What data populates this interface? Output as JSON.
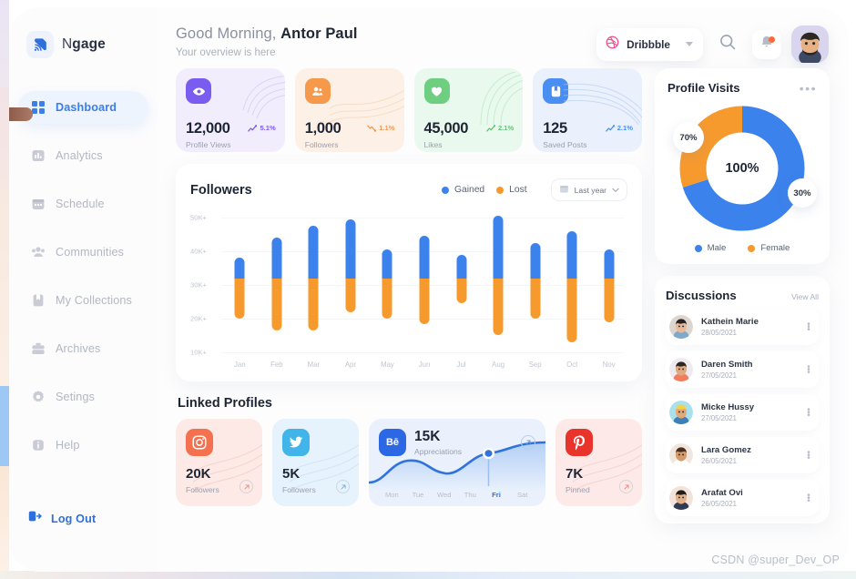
{
  "brand": {
    "name_prefix": "N",
    "name_suffix": "gage",
    "logo_icon": "cast-signal-icon"
  },
  "sidebar": {
    "items": [
      {
        "label": "Dashboard",
        "icon": "grid-icon",
        "active": true
      },
      {
        "label": "Analytics",
        "icon": "bar-chart-icon",
        "active": false
      },
      {
        "label": "Schedule",
        "icon": "calendar-icon",
        "active": false
      },
      {
        "label": "Communities",
        "icon": "people-icon",
        "active": false
      },
      {
        "label": "My Collections",
        "icon": "bookmark-icon",
        "active": false
      },
      {
        "label": "Archives",
        "icon": "briefcase-icon",
        "active": false
      },
      {
        "label": "Setings",
        "icon": "gear-icon",
        "active": false
      },
      {
        "label": "Help",
        "icon": "info-icon",
        "active": false
      }
    ],
    "logout": {
      "label": "Log Out",
      "icon": "logout-icon"
    }
  },
  "header": {
    "greeting_prefix": "Good Morning, ",
    "greeting_name": "Antor Paul",
    "subtitle": "Your overview is here",
    "brand_pill": {
      "label": "Dribbble",
      "icon": "dribbble-icon"
    },
    "search_icon": "search-icon",
    "bell_icon": "bell-icon",
    "avatar": "user-avatar"
  },
  "stats": [
    {
      "value": "12,000",
      "label": "Profile Views",
      "delta": "5.1%",
      "trend": "up",
      "icon": "eye-icon",
      "accent": "#7b5cf0",
      "bg": "#f1edfd",
      "delta_color": "#7b5cf0"
    },
    {
      "value": "1,000",
      "label": "Followers",
      "delta": "1.1%",
      "trend": "down",
      "icon": "users-icon",
      "accent": "#f6994a",
      "bg": "#fdf0e6",
      "delta_color": "#f0984d"
    },
    {
      "value": "45,000",
      "label": "Likes",
      "delta": "2.1%",
      "trend": "up",
      "icon": "heart-icon",
      "accent": "#6dcf7f",
      "bg": "#eaf9ee",
      "delta_color": "#5ec473"
    },
    {
      "value": "125",
      "label": "Saved Posts",
      "delta": "2.1%",
      "trend": "up",
      "icon": "bookmark-icon",
      "accent": "#4b8ef2",
      "bg": "#eaf1fd",
      "delta_color": "#4b8ef2"
    }
  ],
  "followers_card": {
    "title": "Followers",
    "legend": [
      {
        "label": "Gained",
        "color": "#3b82ec"
      },
      {
        "label": "Lost",
        "color": "#f79a2e"
      }
    ],
    "range": {
      "label": "Last year",
      "icon": "calendar-icon"
    }
  },
  "chart_data": {
    "type": "bar",
    "title": "Followers",
    "xlabel": "",
    "ylabel": "",
    "ylim": [
      5000,
      55000
    ],
    "ytick_labels": [
      "50K+",
      "40K+",
      "30K+",
      "20K+",
      "10K+"
    ],
    "ytick_values": [
      50000,
      40000,
      30000,
      20000,
      10000
    ],
    "categories": [
      "Jan",
      "Feb",
      "Mar",
      "Apr",
      "May",
      "Jun",
      "Jul",
      "Aug",
      "Sep",
      "Oct",
      "Nov"
    ],
    "grid": true,
    "legend_position": "top-right",
    "stacked_split_value": 32000,
    "series": [
      {
        "name": "Gained",
        "color": "#3b82ec",
        "values": [
          38000,
          44000,
          47500,
          49500,
          40500,
          44500,
          39000,
          50500,
          42500,
          46000,
          40500
        ]
      },
      {
        "name": "Lost",
        "color": "#f79a2e",
        "values": [
          20000,
          16500,
          16500,
          22000,
          20000,
          18500,
          24500,
          15000,
          20000,
          13000,
          19000
        ]
      }
    ]
  },
  "linked_profiles": {
    "title": "Linked Profiles",
    "cards": [
      {
        "kind": "simple",
        "network": "instagram",
        "icon": "instagram-icon",
        "value": "20K",
        "label": "Followers",
        "bg": "#fdeae6",
        "icon_bg": "#f4714f"
      },
      {
        "kind": "simple",
        "network": "twitter",
        "icon": "twitter-icon",
        "value": "5K",
        "label": "Followers",
        "bg": "#e6f2fc",
        "icon_bg": "#41b4ea"
      },
      {
        "kind": "chart",
        "network": "behance",
        "icon": "behance-icon",
        "value": "15K",
        "label": "Appreciations",
        "bg": "#eaf1fc",
        "icon_bg": "#2c68e4",
        "days": [
          "Mon",
          "Tue",
          "Wed",
          "Thu",
          "Fri",
          "Sat"
        ],
        "active_day": "Fri"
      },
      {
        "kind": "simple",
        "network": "pinterest",
        "icon": "pinterest-icon",
        "value": "7K",
        "label": "Pinned",
        "bg": "#fdeae8",
        "icon_bg": "#e8342a"
      }
    ]
  },
  "profile_visits": {
    "title": "Profile Visits",
    "menu_icon": "more-horizontal-icon",
    "center_label": "100%",
    "segments": [
      {
        "label": "Male",
        "value": 70,
        "display": "70%",
        "color": "#3b82ec"
      },
      {
        "label": "Female",
        "value": 30,
        "display": "30%",
        "color": "#f79a2e"
      }
    ]
  },
  "discussions": {
    "title": "Discussions",
    "view_all": "View All",
    "items": [
      {
        "name": "Kathein Marie",
        "date": "28/05/2021",
        "avatar_bg": "#ddd6cf",
        "skin": "#e8b99a",
        "hair": "#2b2320",
        "shirt": "#7fa9c9"
      },
      {
        "name": "Daren Smith",
        "date": "27/05/2021",
        "avatar_bg": "#eeeaf0",
        "skin": "#e0a97f",
        "hair": "#2e2622",
        "shirt": "#ef7d5e"
      },
      {
        "name": "Micke Hussy",
        "date": "27/05/2021",
        "avatar_bg": "#a9e0ee",
        "skin": "#e3a878",
        "hair": "#f3d24a",
        "shirt": "#3e7fb5"
      },
      {
        "name": "Lara Gomez",
        "date": "26/05/2021",
        "avatar_bg": "#f0e6dc",
        "skin": "#d49a6c",
        "hair": "#4a2e1f",
        "shirt": "#ffffff"
      },
      {
        "name": "Arafat Ovi",
        "date": "26/05/2021",
        "avatar_bg": "#f2e2d8",
        "skin": "#e3b08a",
        "hair": "#241c18",
        "shirt": "#2f3b52"
      }
    ]
  },
  "watermark": "CSDN @super_Dev_OP"
}
